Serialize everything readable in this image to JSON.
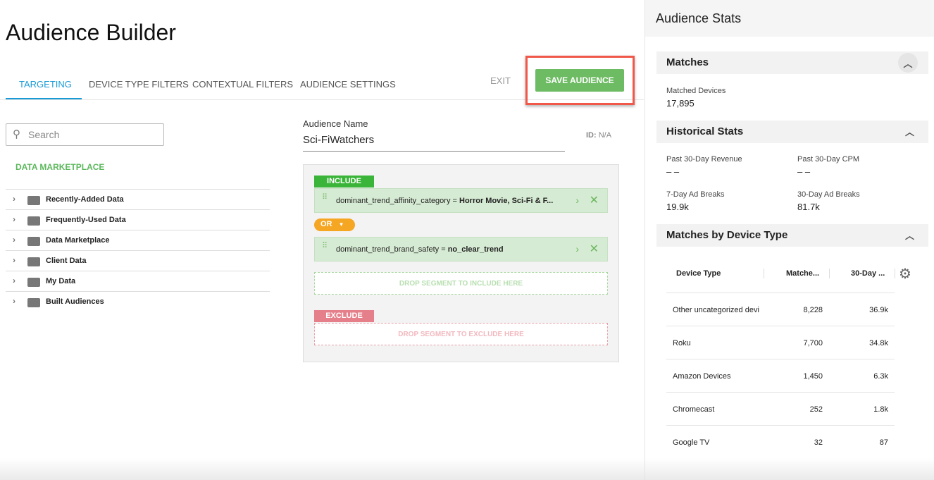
{
  "title": "Audience Builder",
  "tabs": [
    "TARGETING",
    "DEVICE TYPE FILTERS",
    "CONTEXTUAL FILTERS",
    "AUDIENCE SETTINGS"
  ],
  "exit_label": "EXIT",
  "save_label": "SAVE AUDIENCE",
  "search_placeholder": "Search",
  "marketplace_link": "DATA MARKETPLACE",
  "tree": [
    "Recently-Added Data",
    "Frequently-Used Data",
    "Data Marketplace",
    "Client Data",
    "My Data",
    "Built Audiences"
  ],
  "audience_name_label": "Audience Name",
  "audience_name_value": "Sci-FiWatchers",
  "id_label": "ID:",
  "id_value": "N/A",
  "include_label": "INCLUDE",
  "rules": [
    {
      "key": "dominant_trend_affinity_category =",
      "value": "Horror Movie, Sci-Fi & F..."
    },
    {
      "key": "dominant_trend_brand_safety =",
      "value": "no_clear_trend"
    }
  ],
  "operator": "OR",
  "drop_include": "DROP SEGMENT TO INCLUDE HERE",
  "exclude_label": "EXCLUDE",
  "drop_exclude": "DROP SEGMENT TO EXCLUDE HERE",
  "stats": {
    "title": "Audience Stats",
    "matches": {
      "title": "Matches",
      "label": "Matched Devices",
      "value": "17,895"
    },
    "historical": {
      "title": "Historical Stats",
      "items": [
        {
          "label": "Past 30-Day Revenue",
          "value": "– –"
        },
        {
          "label": "Past 30-Day CPM",
          "value": "– –"
        },
        {
          "label": "7-Day Ad Breaks",
          "value": "19.9k"
        },
        {
          "label": "30-Day Ad Breaks",
          "value": "81.7k"
        }
      ]
    },
    "device": {
      "title": "Matches by Device Type",
      "columns": [
        "Device Type",
        "Matche...",
        "30-Day ..."
      ],
      "rows": [
        [
          "Other uncategorized devi",
          "8,228",
          "36.9k"
        ],
        [
          "Roku",
          "7,700",
          "34.8k"
        ],
        [
          "Amazon Devices",
          "1,450",
          "6.3k"
        ],
        [
          "Chromecast",
          "252",
          "1.8k"
        ],
        [
          "Google TV",
          "32",
          "87"
        ]
      ]
    }
  },
  "colors": {
    "accent": "#1a9bd7",
    "save": "#6dbb63",
    "include": "#3ab53a",
    "or": "#f5a623",
    "exclude": "#e57f8a",
    "highlight": "#f0594a"
  }
}
